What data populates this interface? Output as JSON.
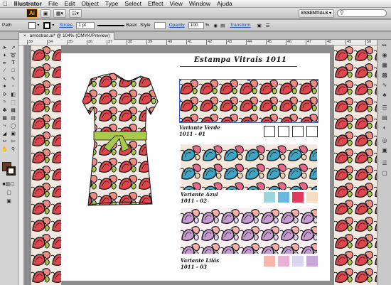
{
  "menubar": {
    "apple_icon": "apple-icon",
    "items": [
      "Illustrator",
      "File",
      "Edit",
      "Object",
      "Type",
      "Select",
      "Effect",
      "View",
      "Window",
      "Ajuda"
    ]
  },
  "appbar": {
    "logo": "Ai",
    "workspace": "ESSENTIALS ▾",
    "search_placeholder": ""
  },
  "control_bar": {
    "selection": "Path",
    "stroke_label": "Stroke",
    "stroke_value": "1 pt",
    "brush_label": "Basic",
    "style_label": "Style",
    "opacity_label": "Opacity",
    "opacity_value": "100",
    "percent": "%",
    "transform_label": "Transform"
  },
  "document_tab": {
    "title": "amostras.ai* @ 104% (CMYK/Preview)",
    "close": "×"
  },
  "ruler": {
    "ticks": [
      "33",
      "34",
      "35",
      "36",
      "37",
      "38",
      "39",
      "40",
      "41",
      "42",
      "43",
      "44",
      "45",
      "46",
      "47",
      "48",
      "49",
      "50"
    ]
  },
  "artboard": {
    "title": "Estampa Vitrais 1011",
    "variants": [
      {
        "label": "Variante Verde",
        "code": "1011 - 01",
        "swatches": [
          "#ffffff",
          "#ffffff",
          "#ffffff",
          "#ffffff"
        ]
      },
      {
        "label": "Variante Azul",
        "code": "1011 - 02",
        "swatches": [
          "#9dd5df",
          "#6ab8e0",
          "#e03a5c",
          "#f6dcc0"
        ]
      },
      {
        "label": "Variante Lilás",
        "code": "1011 - 03",
        "swatches": [
          "#f6b6aa",
          "#e9b0d8",
          "#d9d6ef",
          "#c7a8d9"
        ]
      }
    ]
  },
  "colors": {
    "accent_red": "#d9473f",
    "accent_green": "#a9c94a",
    "accent_blue": "#3fa5c4",
    "accent_lilac": "#c79ad0",
    "selection_blue": "#3d5ec9"
  }
}
